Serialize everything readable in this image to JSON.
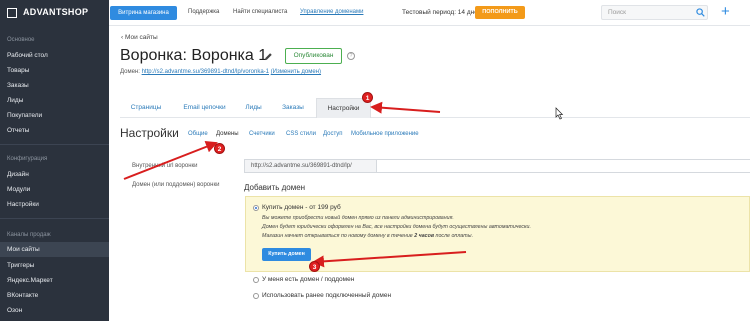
{
  "topbar": {
    "logo_text": "ADVANTSHOP",
    "storefront_button": "Витрина магазина",
    "links": [
      "Поддержка",
      "Найти специалиста",
      "Управление доменами"
    ],
    "trial_text": "Тестовый период: 14 дней",
    "topup_button": "ПОПОЛНИТЬ",
    "search_placeholder": "Поиск",
    "colors": {
      "accent": "#2f8be0",
      "topup": "#f39a19",
      "sidebar": "#2b323d"
    }
  },
  "sidebar": {
    "heading_main": "Основное",
    "items_main": [
      "Рабочий стол",
      "Товары",
      "Заказы",
      "Лиды",
      "Покупатели",
      "Отчеты"
    ],
    "heading_config": "Конфигурация",
    "items_config": [
      "Дизайн",
      "Модули",
      "Настройки"
    ],
    "heading_channels": "Каналы продаж",
    "items_channels": [
      "Мои сайты",
      "Триггеры",
      "Яндекс.Маркет",
      "ВКонтакте",
      "Озон"
    ],
    "active_item": "Мои сайты"
  },
  "page": {
    "back_link": "Мои сайты",
    "title": "Воронка: Воронка 1",
    "status_badge": "Опубликован",
    "domain_label": "Домен:",
    "domain_url": "http://s2.advantme.su/369891-dtnd/lp/voronka-1",
    "change_domain": "(Изменить домен)"
  },
  "tabs": [
    "Страницы",
    "Email цепочки",
    "Лиды",
    "Заказы",
    "Настройки"
  ],
  "active_tab": "Настройки",
  "settings": {
    "title": "Настройки",
    "subtabs": [
      "Общие",
      "Домены",
      "Счетчики",
      "CSS стили",
      "Доступ",
      "Мобильное приложение"
    ],
    "active_subtab": "Домены",
    "inner_url_label": "Внутренний url воронки",
    "inner_url_value": "http://s2.advantme.su/369891-dtnd/lp/",
    "domain_label": "Домен (или поддомен) воронки",
    "add_domain_title": "Добавить домен",
    "option_buy": "Купить домен - от 199 руб",
    "info_line1": "Вы можете приобрести новый домен прямо из панели администрирования.",
    "info_line2": "Домен будет юридически оформлен на Вас, все настройки домена будут осуществлены автоматически.",
    "info_line3_a": "Магазин начнет открываться по новому домену в течение",
    "info_line3_b": "2 часов",
    "info_line3_c": "после оплаты.",
    "buy_button": "Купить домен",
    "option_own": "У меня есть домен / поддомен",
    "option_prev": "Использовать ранее подключенный домен"
  },
  "annotations": {
    "markers": [
      "1",
      "2",
      "3"
    ],
    "arrow_color": "#d81e1e"
  }
}
